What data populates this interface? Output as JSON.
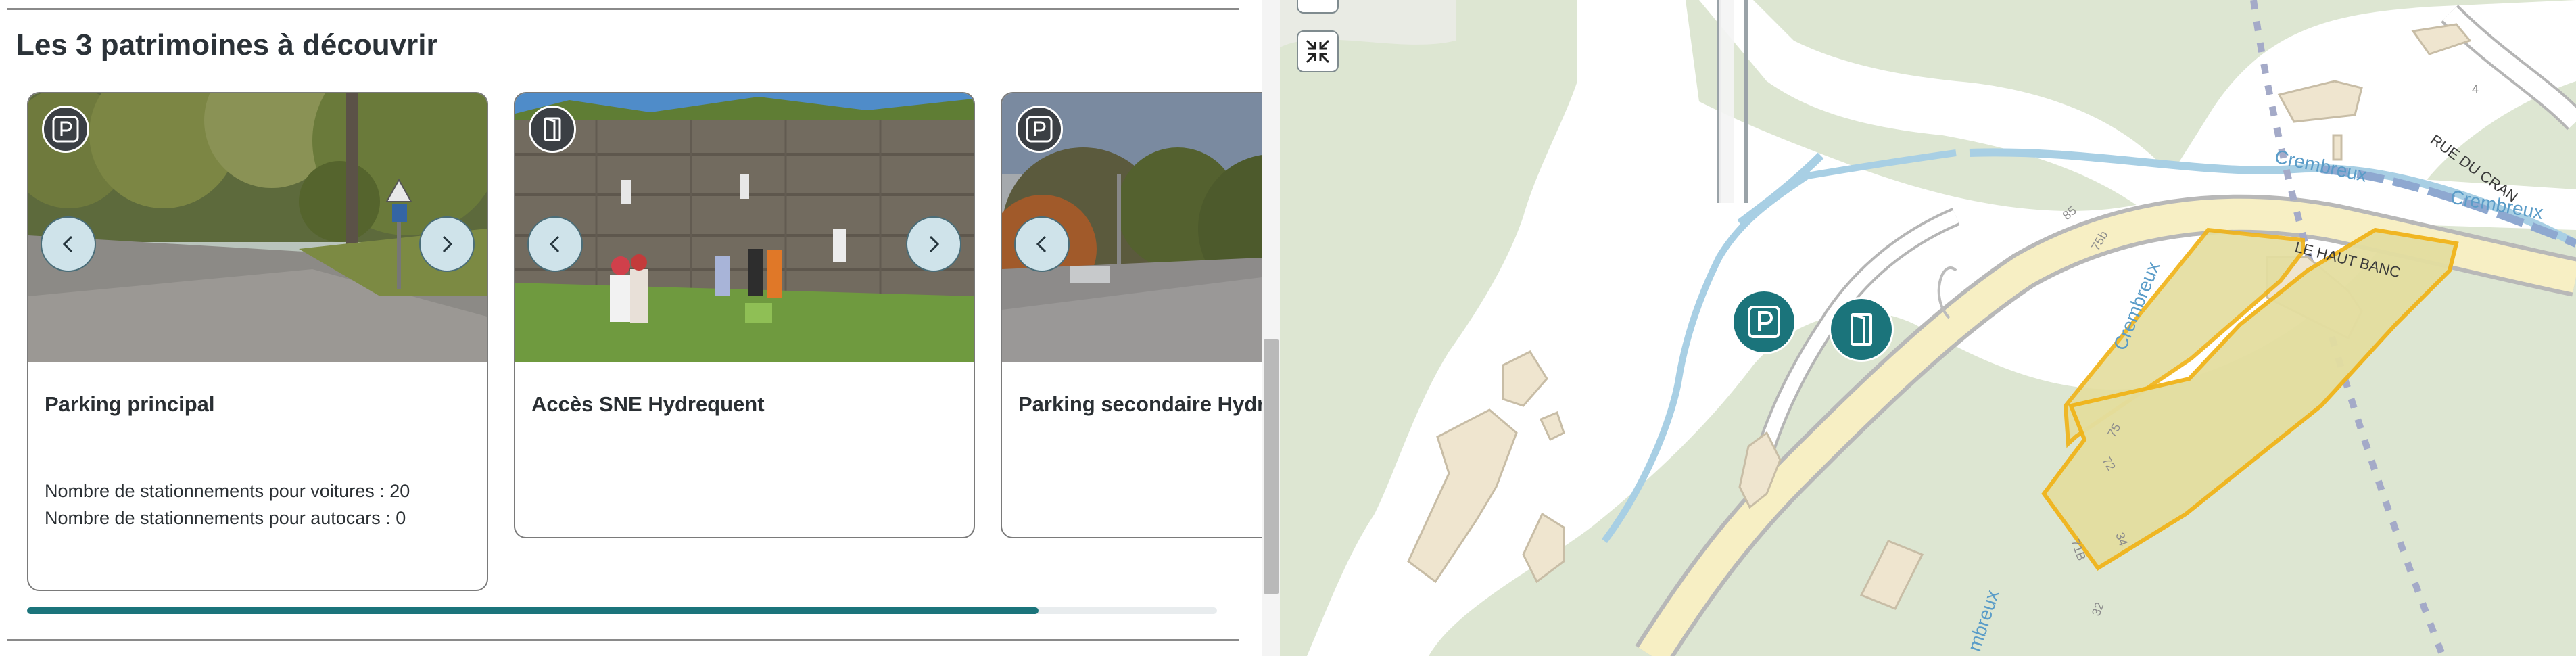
{
  "section": {
    "title": "Les 3 patrimoines à découvrir"
  },
  "cards": [
    {
      "category_icon": "parking-icon",
      "title": "Parking principal",
      "details": [
        "Nombre de stationnements pour voitures : 20",
        "Nombre de stationnements pour autocars : 0"
      ]
    },
    {
      "category_icon": "door-icon",
      "title": "Accès SNE Hydrequent",
      "details": []
    },
    {
      "category_icon": "parking-icon",
      "title": "Parking secondaire Hydrequent",
      "details": []
    }
  ],
  "carousel": {
    "progress": 0.85
  },
  "map": {
    "labels": {
      "crembreux_1": "Crembreux",
      "crembreux_2": "Crembreux",
      "crembreux_3": "Crembreux",
      "crembreux_4": "mbreux",
      "haut_banc": "LE HAUT BANC",
      "rue_du_cran": "RUE DU CRAN",
      "n85": "85",
      "n75b": "75b",
      "n75": "75",
      "n72": "72",
      "n71b": "71B",
      "n34": "34",
      "n32": "32",
      "n4": "4"
    },
    "markers": [
      {
        "icon": "parking-icon",
        "type": "parking"
      },
      {
        "icon": "door-icon",
        "type": "access"
      }
    ],
    "colors": {
      "background": "#dde6d2",
      "built_area": "#ffffff",
      "road_fill": "#f7efc4",
      "road_edge": "#b8b8b8",
      "water": "#a8cfe4",
      "area_outline": "#f0b41a",
      "area_fill": "#e4dea0",
      "marker": "#1b747b",
      "building": "#efe5cf"
    }
  },
  "colors": {
    "accent": "#1b747b",
    "nav_button": "#cfe3ea"
  }
}
